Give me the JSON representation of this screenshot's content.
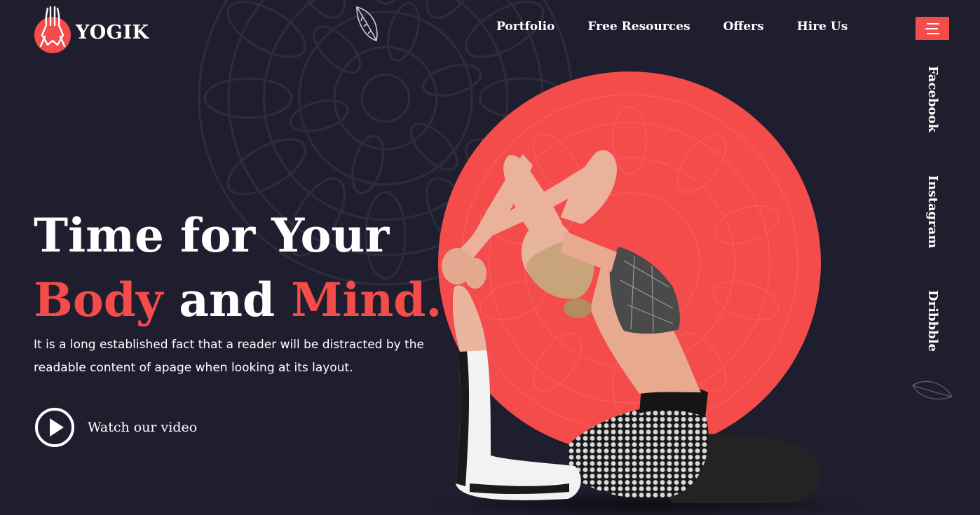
{
  "brand": {
    "name": "YOGIK",
    "accent": "#f44b4b",
    "background": "#1e1e2e"
  },
  "nav": {
    "items": [
      {
        "label": "Portfolio"
      },
      {
        "label": "Free Resources"
      },
      {
        "label": "Offers"
      },
      {
        "label": "Hire Us"
      }
    ],
    "menu_icon": "hamburger-icon"
  },
  "social": {
    "items": [
      {
        "label": "Facebook"
      },
      {
        "label": "Instagram"
      },
      {
        "label": "Dribbble"
      }
    ]
  },
  "hero": {
    "title_line1": "Time for Your",
    "title_word1": "Body",
    "title_word2": " and ",
    "title_word3": "Mind.",
    "description": "It is a long established fact that a reader will be distracted by the readable content of apage when looking at its layout.",
    "cta_label": "Watch our video",
    "cta_icon": "play-icon"
  }
}
